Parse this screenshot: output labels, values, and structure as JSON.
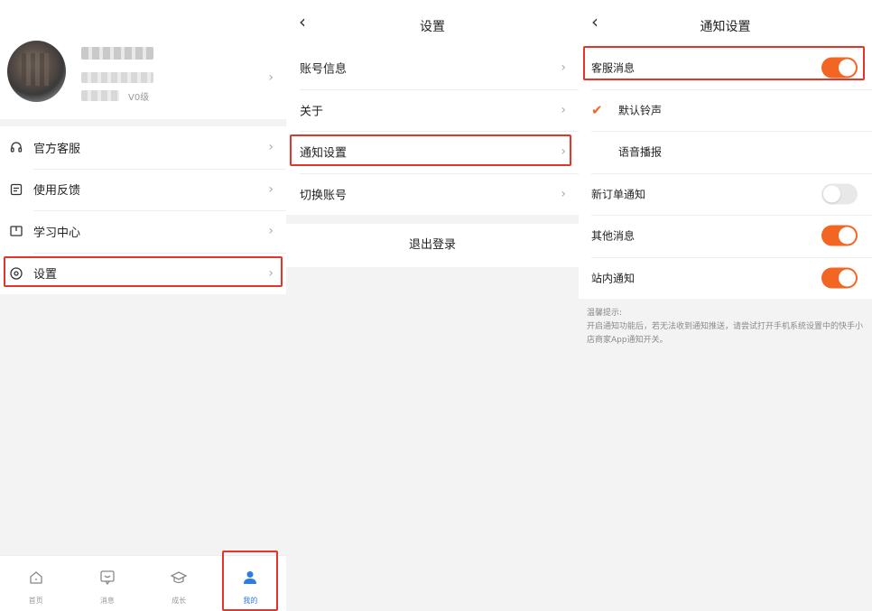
{
  "panel_profile": {
    "level_text": "V0级",
    "menu": [
      {
        "label": "官方客服",
        "icon": "headset-icon"
      },
      {
        "label": "使用反馈",
        "icon": "feedback-icon"
      },
      {
        "label": "学习中心",
        "icon": "book-icon"
      },
      {
        "label": "设置",
        "icon": "settings-icon"
      }
    ],
    "tabs": [
      {
        "label": "首页",
        "icon": "home-icon"
      },
      {
        "label": "消息",
        "icon": "message-icon"
      },
      {
        "label": "成长",
        "icon": "graduation-icon"
      },
      {
        "label": "我的",
        "icon": "user-icon"
      }
    ],
    "active_tab": 3,
    "accent_color": "#2d7be5"
  },
  "panel_settings": {
    "title": "设置",
    "items": [
      {
        "label": "账号信息"
      },
      {
        "label": "关于"
      },
      {
        "label": "通知设置"
      },
      {
        "label": "切换账号"
      }
    ],
    "logout_label": "退出登录"
  },
  "panel_notify": {
    "title": "通知设置",
    "rows": [
      {
        "label": "客服消息",
        "toggle": true
      },
      {
        "label": "默认铃声",
        "checked": true
      },
      {
        "label": "语音播报",
        "checked": false
      },
      {
        "label": "新订单通知",
        "toggle": false
      },
      {
        "label": "其他消息",
        "toggle": true
      },
      {
        "label": "站内通知",
        "toggle": true
      }
    ],
    "tips_title": "温馨提示:",
    "tips_body": "开启通知功能后，若无法收到通知推送，请尝试打开手机系统设置中的快手小店商家App通知开关。",
    "accent_color": "#f26522"
  },
  "highlight_color": "#e5352a"
}
